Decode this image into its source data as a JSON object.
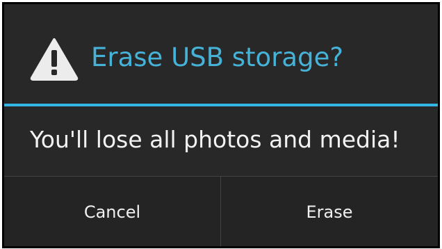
{
  "dialog": {
    "icon": "warning-icon",
    "title": "Erase USB storage?",
    "message": "You'll lose all photos and media!",
    "accent_color": "#33b5e5",
    "buttons": {
      "cancel": "Cancel",
      "erase": "Erase"
    }
  }
}
